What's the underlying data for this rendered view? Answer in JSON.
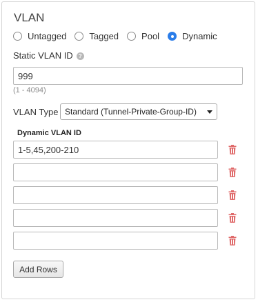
{
  "section": {
    "title": "VLAN"
  },
  "vlan_mode": {
    "options": [
      {
        "label": "Untagged",
        "checked": false
      },
      {
        "label": "Tagged",
        "checked": false
      },
      {
        "label": "Pool",
        "checked": false
      },
      {
        "label": "Dynamic",
        "checked": true
      }
    ]
  },
  "static_vlan": {
    "label": "Static VLAN ID",
    "help_icon": "question-circle-icon",
    "value": "999",
    "range_hint": "(1 - 4094)"
  },
  "vlan_type": {
    "label": "VLAN Type",
    "selected": "Standard (Tunnel-Private-Group-ID)"
  },
  "dynamic_vlan": {
    "header": "Dynamic VLAN ID",
    "rows": [
      {
        "value": "1-5,45,200-210"
      },
      {
        "value": ""
      },
      {
        "value": ""
      },
      {
        "value": ""
      },
      {
        "value": ""
      }
    ],
    "delete_icon": "trash-icon"
  },
  "actions": {
    "add_rows_label": "Add Rows"
  },
  "colors": {
    "accent": "#2b7de9",
    "delete": "#e06b6b",
    "border": "#b9b9b9",
    "hint": "#8c8c8c"
  }
}
